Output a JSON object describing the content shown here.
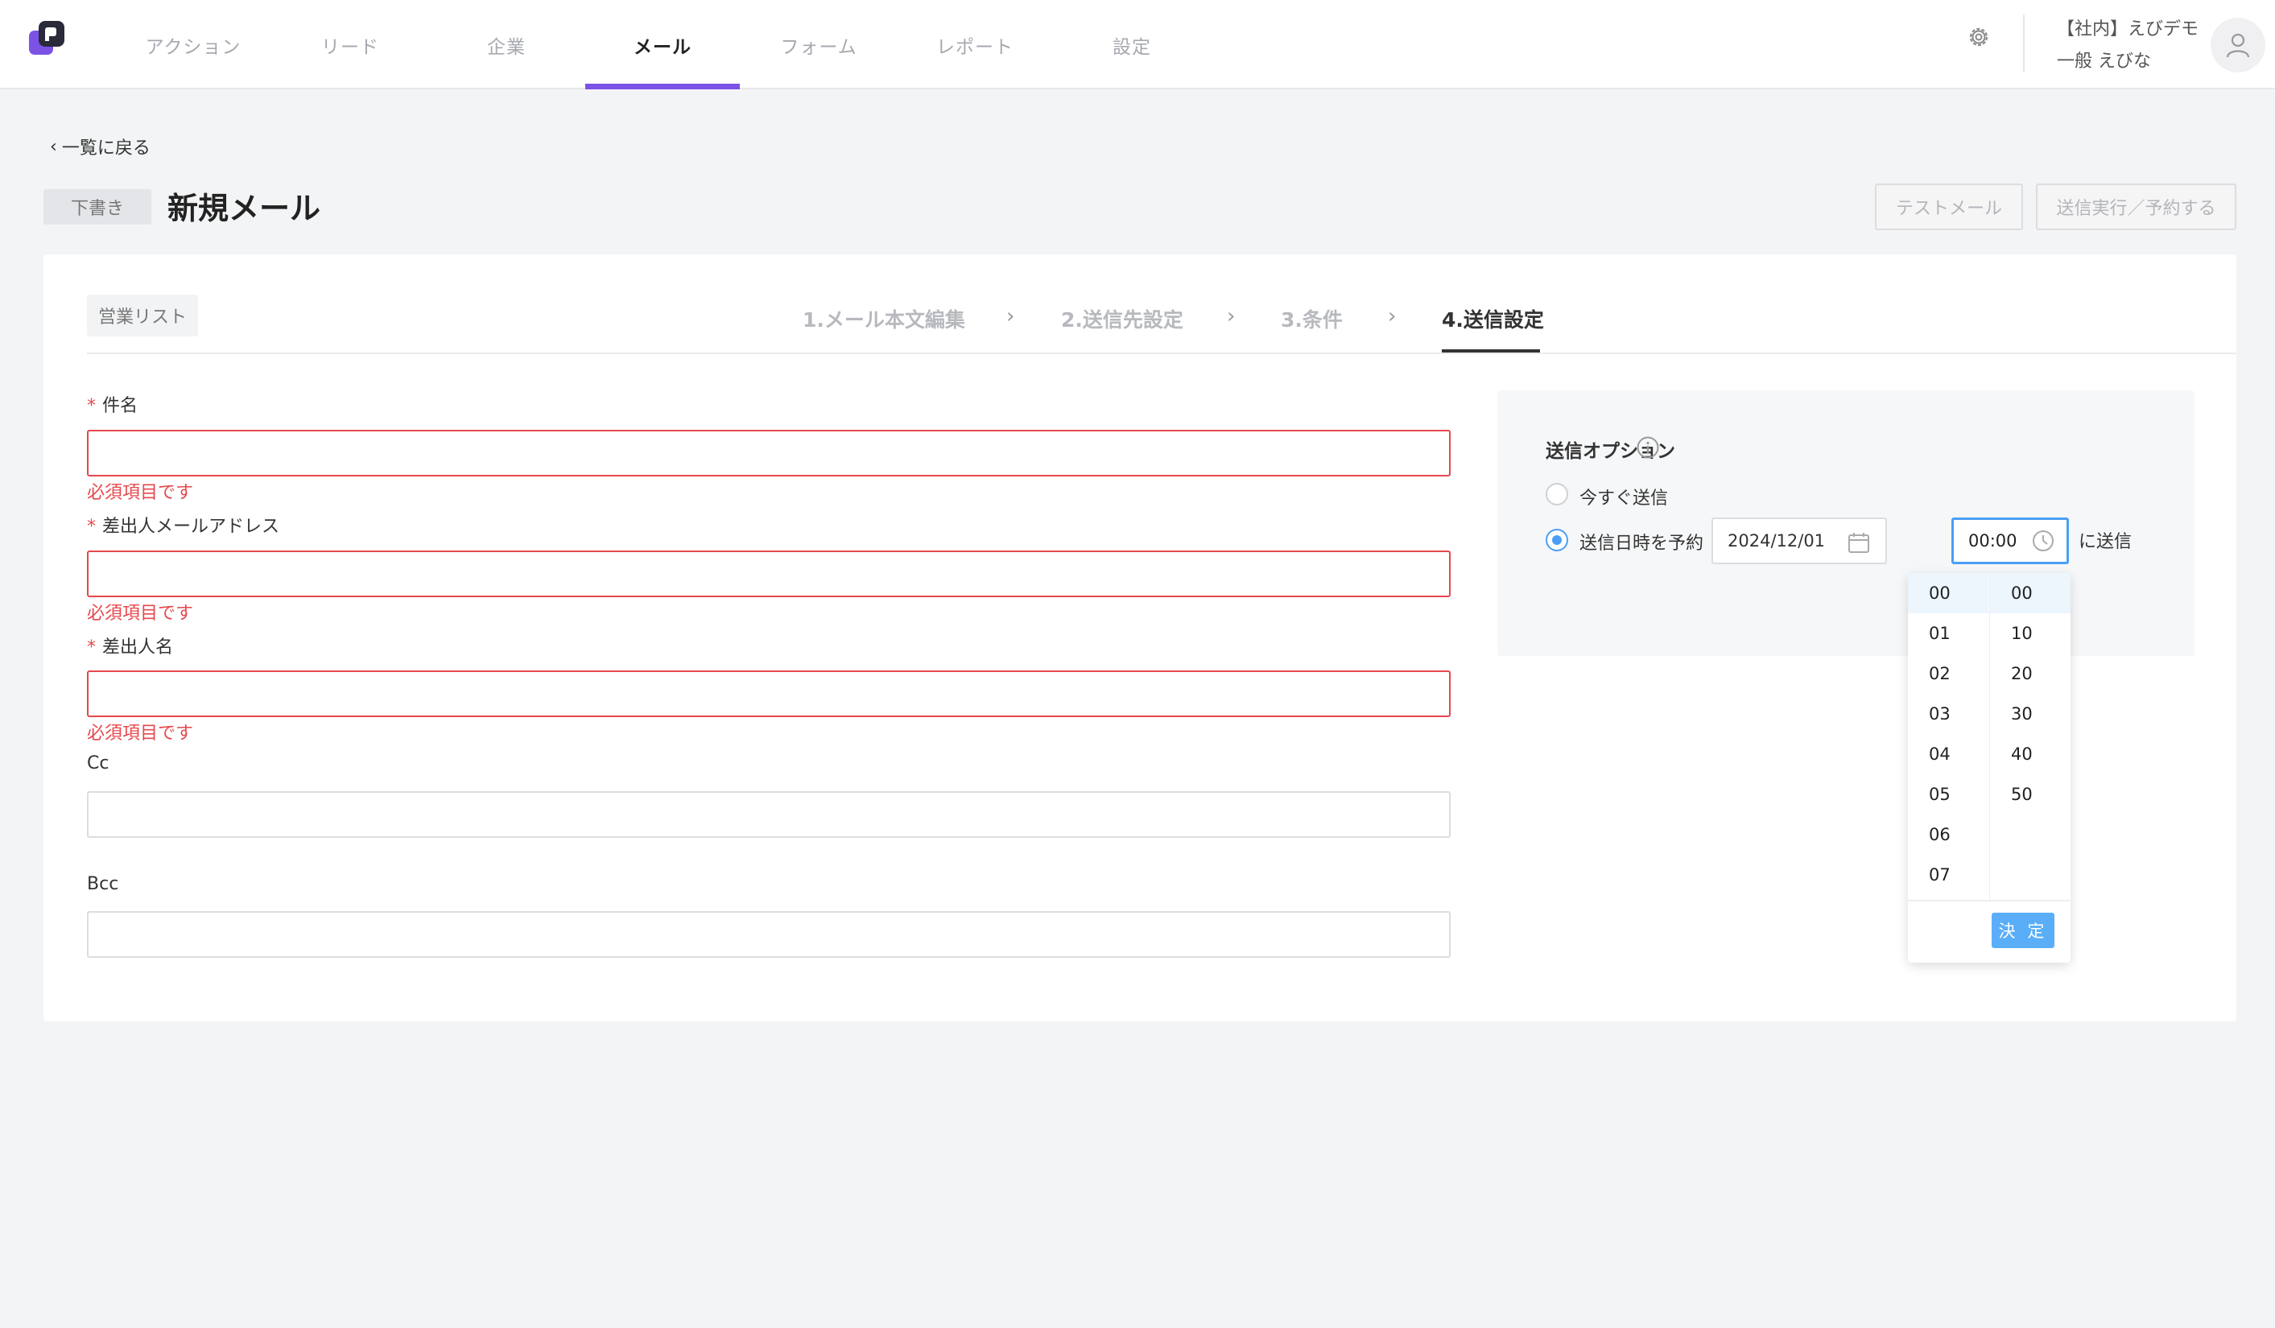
{
  "nav": {
    "tabs": [
      {
        "label": "アクション"
      },
      {
        "label": "リード"
      },
      {
        "label": "企業"
      },
      {
        "label": "メール"
      },
      {
        "label": "フォーム"
      },
      {
        "label": "レポート"
      },
      {
        "label": "設定"
      }
    ],
    "active_tab": "メール",
    "user_org": "【社内】えびデモ",
    "user_name": "一般 えびな"
  },
  "header": {
    "back_label": "一覧に戻る",
    "status_badge": "下書き",
    "title": "新規メール",
    "test_mail_label": "テストメール",
    "send_label": "送信実行／予約する"
  },
  "steps": {
    "list_tag": "営業リスト",
    "items": [
      {
        "label": "1.メール本文編集"
      },
      {
        "label": "2.送信先設定"
      },
      {
        "label": "3.条件"
      },
      {
        "label": "4.送信設定"
      }
    ],
    "active": "4.送信設定"
  },
  "form": {
    "subject": {
      "label": "件名",
      "value": "",
      "error": "必須項目です"
    },
    "from_email": {
      "label": "差出人メールアドレス",
      "value": "",
      "error": "必須項目です"
    },
    "from_name": {
      "label": "差出人名",
      "value": "",
      "error": "必須項目です"
    },
    "cc": {
      "label": "Cc",
      "value": ""
    },
    "bcc": {
      "label": "Bcc",
      "value": ""
    }
  },
  "send_options": {
    "title": "送信オプション",
    "now_label": "今すぐ送信",
    "schedule_label": "送信日時を予約",
    "selected": "schedule",
    "date": "2024/12/01",
    "time": "00:00",
    "suffix": "に送信"
  },
  "time_picker": {
    "hours": [
      "00",
      "01",
      "02",
      "03",
      "04",
      "05",
      "06",
      "07"
    ],
    "minutes": [
      "00",
      "10",
      "20",
      "30",
      "40",
      "50"
    ],
    "selected_hour": "00",
    "selected_minute": "00",
    "confirm_label": "決 定"
  },
  "colors": {
    "accent": "#7b52e4",
    "primary": "#4a9ff5",
    "error": "#e5484d"
  }
}
